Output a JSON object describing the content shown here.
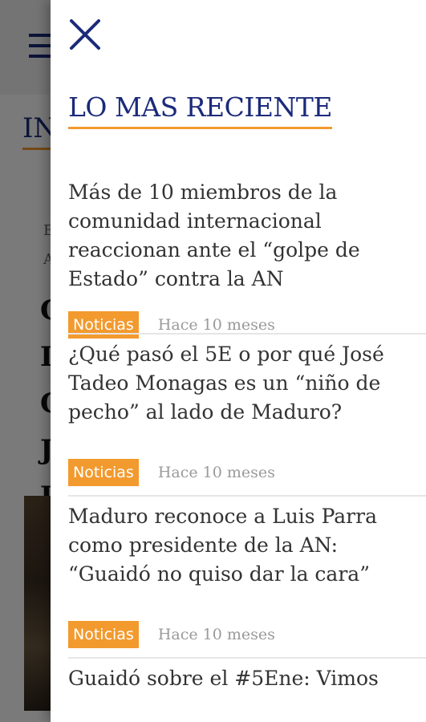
{
  "background": {
    "section_initials": "IN",
    "meta_letters": [
      "E",
      "A"
    ],
    "headline_letters": [
      "C",
      "I",
      "C",
      "J",
      "I"
    ]
  },
  "drawer": {
    "close_icon": "close-icon",
    "title": "LO MAS RECIENTE",
    "items": [
      {
        "title": "Más de 10 miembros de la\ncomunidad internacional\nreaccionan ante el “golpe de\nEstado” contra la AN",
        "category": "Noticias",
        "time": "Hace 10 meses"
      },
      {
        "title": "¿Qué pasó el 5E o por qué José\nTadeo Monagas es un “niño de\npecho” al lado de Maduro?",
        "category": "Noticias",
        "time": "Hace 10 meses"
      },
      {
        "title": "Maduro reconoce a Luis Parra\ncomo presidente de la AN:\n“Guaidó no quiso dar la cara”",
        "category": "Noticias",
        "time": "Hace 10 meses"
      },
      {
        "title": "Guaidó sobre el #5Ene: Vimos"
      }
    ]
  },
  "colors": {
    "accent_orange": "#f29a2e",
    "brand_navy": "#1b2a7a"
  }
}
